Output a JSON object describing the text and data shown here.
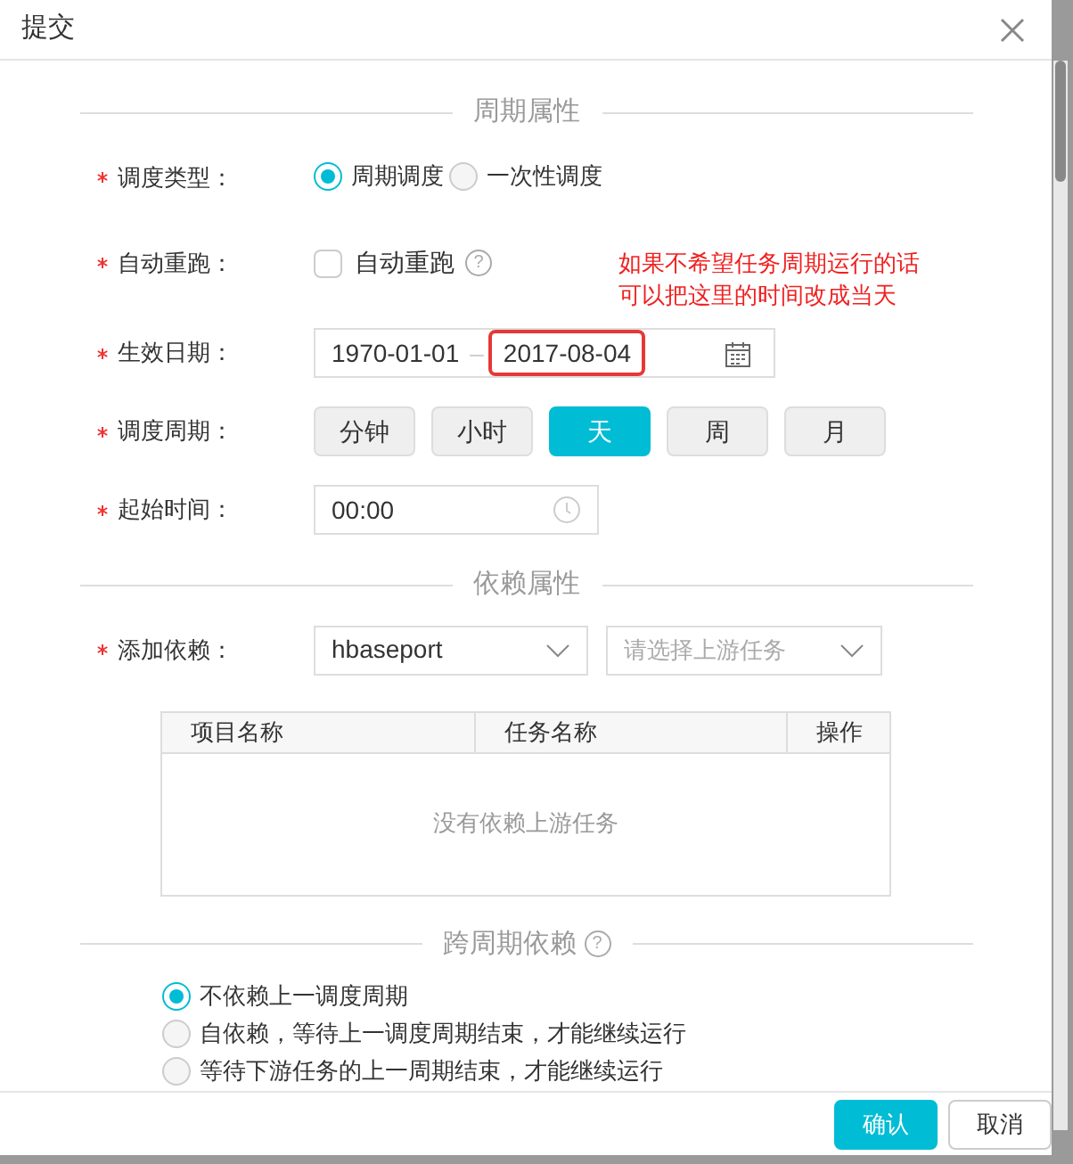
{
  "dialog": {
    "title": "提交"
  },
  "period_section": {
    "title": "周期属性",
    "schedule_type": {
      "label": "调度类型：",
      "required": true,
      "options": [
        {
          "label": "周期调度",
          "selected": true
        },
        {
          "label": "一次性调度",
          "selected": false
        }
      ]
    },
    "auto_rerun": {
      "label": "自动重跑：",
      "required": true,
      "checkbox_label": "自动重跑",
      "checked": false,
      "help": "?"
    },
    "effective_date": {
      "label": "生效日期：",
      "required": true,
      "start": "1970-01-01",
      "separator": "–",
      "end": "2017-08-04"
    },
    "schedule_period": {
      "label": "调度周期：",
      "required": true,
      "options": [
        {
          "label": "分钟",
          "selected": false
        },
        {
          "label": "小时",
          "selected": false
        },
        {
          "label": "天",
          "selected": true
        },
        {
          "label": "周",
          "selected": false
        },
        {
          "label": "月",
          "selected": false
        }
      ]
    },
    "start_time": {
      "label": "起始时间：",
      "required": true,
      "value": "00:00"
    }
  },
  "dependency_section": {
    "title": "依赖属性",
    "add_dependency": {
      "label": "添加依赖：",
      "required": true,
      "project": "hbaseport",
      "task_placeholder": "请选择上游任务"
    },
    "table": {
      "columns": [
        "项目名称",
        "任务名称",
        "操作"
      ],
      "empty_text": "没有依赖上游任务"
    }
  },
  "cross_cycle_section": {
    "title": "跨周期依赖",
    "help": "?",
    "options": [
      {
        "label": "不依赖上一调度周期",
        "selected": true
      },
      {
        "label": "自依赖，等待上一调度周期结束，才能继续运行",
        "selected": false
      },
      {
        "label": "等待下游任务的上一周期结束，才能继续运行",
        "selected": false
      }
    ]
  },
  "annotation": {
    "lines": [
      "如果不希望任务周期运行的话",
      "可以把这里的时间改成当天"
    ]
  },
  "footer": {
    "buttons": [
      {
        "label": "确认",
        "kind": "primary"
      },
      {
        "label": "取消",
        "kind": "secondary"
      }
    ]
  }
}
